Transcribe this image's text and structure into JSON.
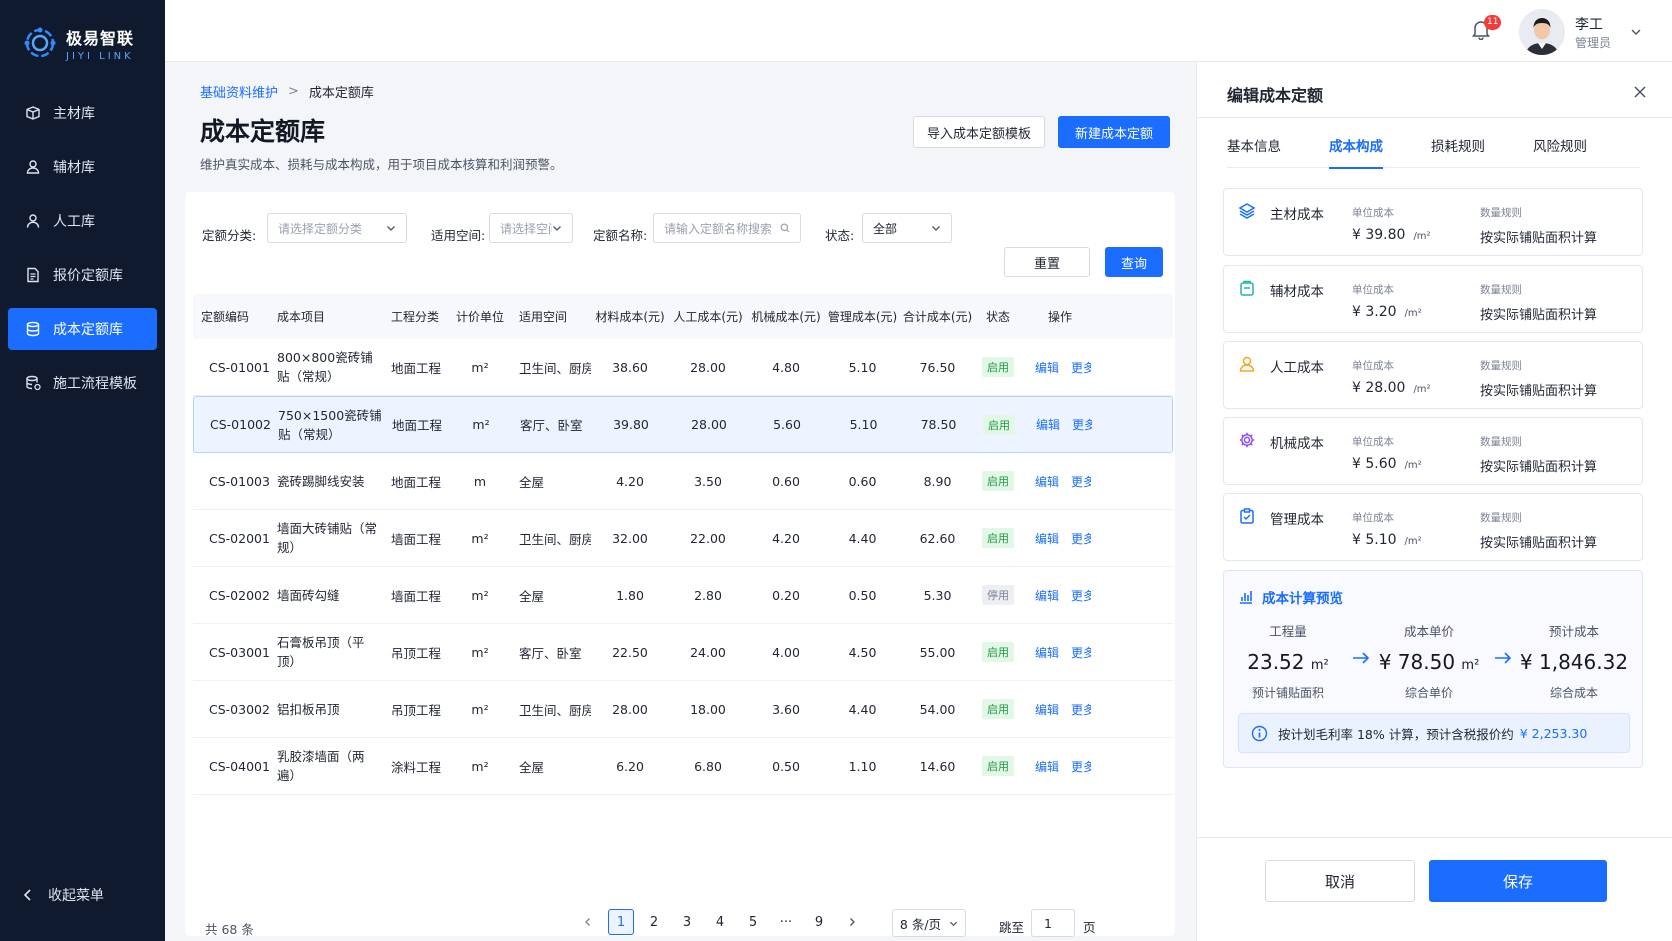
{
  "brand": {
    "name": "极易智联",
    "sub": "JIYI LINK"
  },
  "sidebar": {
    "items": [
      {
        "label": "主材库",
        "icon": "package-icon",
        "active": false
      },
      {
        "label": "辅材库",
        "icon": "user-icon",
        "active": false
      },
      {
        "label": "人工库",
        "icon": "person-icon",
        "active": false
      },
      {
        "label": "报价定额库",
        "icon": "document-icon",
        "active": false
      },
      {
        "label": "成本定额库",
        "icon": "database-icon",
        "active": true
      },
      {
        "label": "施工流程模板",
        "icon": "flow-icon",
        "active": false
      }
    ],
    "collapse_label": "收起菜单"
  },
  "header": {
    "notification_count": "11",
    "user_name": "李工",
    "user_role": "管理员"
  },
  "breadcrumb": {
    "parent": "基础资料维护",
    "sep": ">",
    "current": "成本定额库"
  },
  "page": {
    "title": "成本定额库",
    "description": "维护真实成本、损耗与成本构成，用于项目成本核算和利润预警。",
    "import_label": "导入成本定额模板",
    "new_label": "新建成本定额"
  },
  "filters": {
    "category_label": "定额分类:",
    "category_placeholder": "请选择定额分类",
    "space_label": "适用空间:",
    "space_placeholder": "请选择空间",
    "name_label": "定额名称:",
    "name_placeholder": "请输入定额名称搜索",
    "status_label": "状态:",
    "status_value": "全部",
    "reset_label": "重置",
    "query_label": "查询"
  },
  "table": {
    "columns": [
      "定额编码",
      "成本项目",
      "工程分类",
      "计价单位",
      "适用空间",
      "材料成本(元)",
      "人工成本(元)",
      "机械成本(元)",
      "管理成本(元)",
      "合计成本(元)",
      "状态",
      "操作"
    ],
    "rows": [
      {
        "code": "CS-01001",
        "item": "800×800瓷砖铺贴（常规）",
        "category": "地面工程",
        "unit": "m²",
        "space": "卫生间、厨房",
        "material": "38.60",
        "labor": "28.00",
        "machine": "4.80",
        "manage": "5.10",
        "total": "76.50",
        "status": "启用",
        "edit": "编辑",
        "more": "更多"
      },
      {
        "code": "CS-01002",
        "item": "750×1500瓷砖铺贴（常规）",
        "category": "地面工程",
        "unit": "m²",
        "space": "客厅、卧室",
        "material": "39.80",
        "labor": "28.00",
        "machine": "5.60",
        "manage": "5.10",
        "total": "78.50",
        "status": "启用",
        "edit": "编辑",
        "more": "更多"
      },
      {
        "code": "CS-01003",
        "item": "瓷砖踢脚线安装",
        "category": "地面工程",
        "unit": "m",
        "space": "全屋",
        "material": "4.20",
        "labor": "3.50",
        "machine": "0.60",
        "manage": "0.60",
        "total": "8.90",
        "status": "启用",
        "edit": "编辑",
        "more": "更多"
      },
      {
        "code": "CS-02001",
        "item": "墙面大砖铺贴（常规）",
        "category": "墙面工程",
        "unit": "m²",
        "space": "卫生间、厨房",
        "material": "32.00",
        "labor": "22.00",
        "machine": "4.20",
        "manage": "4.40",
        "total": "62.60",
        "status": "启用",
        "edit": "编辑",
        "more": "更多"
      },
      {
        "code": "CS-02002",
        "item": "墙面砖勾缝",
        "category": "墙面工程",
        "unit": "m²",
        "space": "全屋",
        "material": "1.80",
        "labor": "2.80",
        "machine": "0.20",
        "manage": "0.50",
        "total": "5.30",
        "status": "停用",
        "edit": "编辑",
        "more": "更多"
      },
      {
        "code": "CS-03001",
        "item": "石膏板吊顶（平顶）",
        "category": "吊顶工程",
        "unit": "m²",
        "space": "客厅、卧室",
        "material": "22.50",
        "labor": "24.00",
        "machine": "4.00",
        "manage": "4.50",
        "total": "55.00",
        "status": "启用",
        "edit": "编辑",
        "more": "更多"
      },
      {
        "code": "CS-03002",
        "item": "铝扣板吊顶",
        "category": "吊顶工程",
        "unit": "m²",
        "space": "卫生间、厨房",
        "material": "28.00",
        "labor": "18.00",
        "machine": "3.60",
        "manage": "4.40",
        "total": "54.00",
        "status": "启用",
        "edit": "编辑",
        "more": "更多"
      },
      {
        "code": "CS-04001",
        "item": "乳胶漆墙面（两遍）",
        "category": "涂料工程",
        "unit": "m²",
        "space": "全屋",
        "material": "6.20",
        "labor": "6.80",
        "machine": "0.50",
        "manage": "1.10",
        "total": "14.60",
        "status": "启用",
        "edit": "编辑",
        "more": "更多"
      }
    ]
  },
  "pagination": {
    "total": "共 68 条",
    "pages": [
      "1",
      "2",
      "3",
      "4",
      "5",
      "···",
      "9"
    ],
    "current": "1",
    "page_size": "8 条/页",
    "jump_label": "跳至",
    "jump_value": "1",
    "jump_unit": "页"
  },
  "panel": {
    "title": "编辑成本定额",
    "tabs": [
      "基本信息",
      "成本构成",
      "损耗规则",
      "风险规则"
    ],
    "active_tab": 1,
    "cost_items": [
      {
        "name": "主材成本",
        "unit_label": "单位成本",
        "price": "¥ 39.80",
        "unit": "/m²",
        "qty_label": "数量规则",
        "qty_rule": "按实际铺贴面积计算",
        "icon": "layers-icon",
        "color": "#1a6dff"
      },
      {
        "name": "辅材成本",
        "unit_label": "单位成本",
        "price": "¥ 3.20",
        "unit": "/m²",
        "qty_label": "数量规则",
        "qty_rule": "按实际铺贴面积计算",
        "icon": "box-icon",
        "color": "#20b7a6"
      },
      {
        "name": "人工成本",
        "unit_label": "单位成本",
        "price": "¥ 28.00",
        "unit": "/m²",
        "qty_label": "数量规则",
        "qty_rule": "按实际铺贴面积计算",
        "icon": "worker-icon",
        "color": "#f5a524"
      },
      {
        "name": "机械成本",
        "unit_label": "单位成本",
        "price": "¥ 5.60",
        "unit": "/m²",
        "qty_label": "数量规则",
        "qty_rule": "按实际铺贴面积计算",
        "icon": "gear-icon",
        "color": "#8a4dff"
      },
      {
        "name": "管理成本",
        "unit_label": "单位成本",
        "price": "¥ 5.10",
        "unit": "/m²",
        "qty_label": "数量规则",
        "qty_rule": "按实际铺贴面积计算",
        "icon": "clipboard-icon",
        "color": "#1a6dff"
      }
    ],
    "preview": {
      "title": "成本计算预览",
      "qty_label": "工程量",
      "qty_value": "23.52",
      "qty_unit": "m²",
      "qty_sub": "预计铺贴面积",
      "price_label": "成本单价",
      "price_value": "¥ 78.50",
      "price_unit": "m²",
      "price_sub": "综合单价",
      "cost_label": "预计成本",
      "cost_value": "¥ 1,846.32",
      "cost_sub": "综合成本",
      "note": "按计划毛利率 18% 计算，预计含税报价约",
      "note_value": "¥ 2,253.30"
    },
    "cancel_label": "取消",
    "save_label": "保存"
  }
}
